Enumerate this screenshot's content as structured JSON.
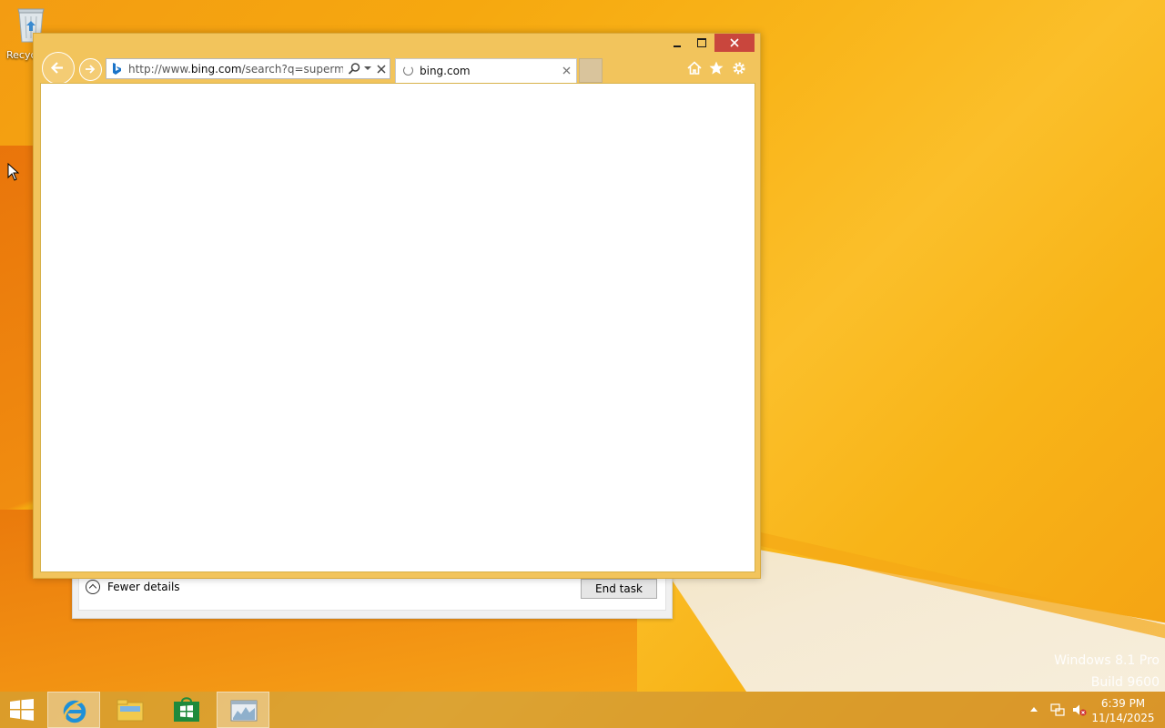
{
  "desktop": {
    "recycle_bin_label": "Recyc"
  },
  "task_manager": {
    "fewer_details_label": "Fewer details",
    "end_task_label": "End task"
  },
  "browser": {
    "address_bar": {
      "url_prefix": "http://www.",
      "url_domain": "bing.com",
      "url_suffix": "/search?q=supermium"
    },
    "tab": {
      "title": "bing.com"
    },
    "icons": [
      "back-arrow-icon",
      "forward-arrow-icon",
      "bing-logo-icon",
      "search-icon",
      "dropdown-icon",
      "close-icon",
      "loading-spinner-icon",
      "home-icon",
      "favorites-star-icon",
      "settings-gear-icon"
    ]
  },
  "taskbar": {
    "apps": [
      "start-button",
      "internet-explorer",
      "file-explorer",
      "store",
      "task-manager"
    ],
    "clock_time": "6:39 PM",
    "clock_date": "11/14/2025"
  },
  "watermark": {
    "line1": "Windows 8.1 Pro",
    "line2": "Build 9600"
  },
  "colors": {
    "window_frame": "#f2c45c",
    "close_button": "#c9463d",
    "wallpaper": "#f9b51a"
  }
}
